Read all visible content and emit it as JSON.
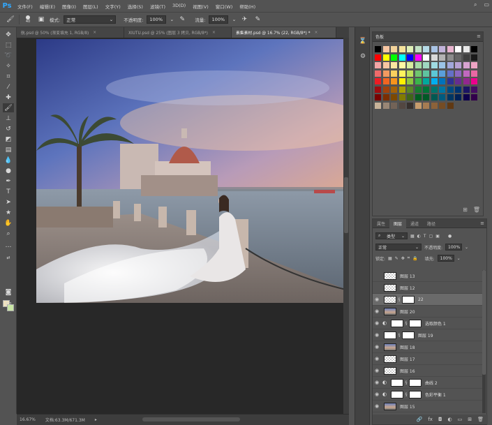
{
  "app": {
    "logo": "Ps"
  },
  "menus": [
    "文件(F)",
    "编辑(E)",
    "图像(I)",
    "图层(L)",
    "文字(Y)",
    "选择(S)",
    "滤镜(T)",
    "3D(D)",
    "视图(V)",
    "窗口(W)",
    "帮助(H)"
  ],
  "options": {
    "brush_size": "40",
    "mode_label": "模式:",
    "mode_value": "正常",
    "opacity_label": "不透明度:",
    "opacity_value": "100%",
    "flow_label": "流量:",
    "flow_value": "100%"
  },
  "tabs": [
    {
      "label": "航.psd @ 50% (渐变填充 1, RGB/8)",
      "close": "×"
    },
    {
      "label": "XIUTU.psd @ 25% (图层 3 拷贝, RGB/8*)",
      "close": "×"
    },
    {
      "label": "素集素材.psd @ 16.7% (22, RGB/8*) *",
      "close": "×"
    }
  ],
  "status": {
    "zoom": "16.67%",
    "doc": "文档:63.3M/671.3M"
  },
  "swatches": {
    "title": "色板",
    "colors": [
      [
        "#000000",
        "#f8c7a3",
        "#f2d29a",
        "#f5e39c",
        "#dff0b8",
        "#c1e0c4",
        "#b6dbe7",
        "#a9c3e4",
        "#c2b3da",
        "#e8b4cf",
        "#ffffff",
        "#e8e8e8",
        "#000000"
      ],
      [
        "#ff0000",
        "#ffff00",
        "#00ff00",
        "#00ffff",
        "#0000ff",
        "#ff00ff",
        "#ffffff",
        "#d9d9d9",
        "#b3b3b3",
        "#8c8c8c",
        "#666666",
        "#404040",
        "#1a1a1a"
      ],
      [
        "#f4a6a6",
        "#f7c6a1",
        "#fbe5a0",
        "#fff7a4",
        "#d7ed9f",
        "#a7dba6",
        "#9fd7c1",
        "#9fdbe2",
        "#9bc4e6",
        "#a2a8db",
        "#b7a1d3",
        "#d8a3d1",
        "#eea4c4"
      ],
      [
        "#ee6a6a",
        "#f29a60",
        "#f9d05e",
        "#fff35e",
        "#bfe05b",
        "#6fc56e",
        "#5fc3a0",
        "#5cc7d5",
        "#5a9fdb",
        "#6470c8",
        "#8b67c0",
        "#c068bf",
        "#e768a2"
      ],
      [
        "#ed1c24",
        "#f26522",
        "#f7941d",
        "#fff200",
        "#8dc63f",
        "#39b54a",
        "#00a99d",
        "#00aeef",
        "#0072bc",
        "#2e3192",
        "#662d91",
        "#92278f",
        "#ec008c"
      ],
      [
        "#9e0b0f",
        "#a0410d",
        "#a36209",
        "#aba000",
        "#598527",
        "#197b30",
        "#007236",
        "#00746b",
        "#0076a3",
        "#004a80",
        "#003471",
        "#1b1464",
        "#440e62"
      ],
      [
        "#790000",
        "#7b2e00",
        "#7d4900",
        "#827b00",
        "#406618",
        "#005e20",
        "#005826",
        "#005952",
        "#005b7f",
        "#003663",
        "#002157",
        "#0d004c",
        "#32004b"
      ],
      [
        "#c7b299",
        "#998675",
        "#736357",
        "#534741",
        "#37302d",
        "#c69c6d",
        "#a67c52",
        "#8c6239",
        "#754c24",
        "#603913"
      ]
    ]
  },
  "layers_panel": {
    "tabs": [
      "属性",
      "图层",
      "通道",
      "路径"
    ],
    "filter_label": "类型",
    "blend_mode": "正常",
    "opacity_label": "不透明度:",
    "opacity_value": "100%",
    "lock_label": "锁定:",
    "fill_label": "填充:",
    "fill_value": "100%",
    "layers": [
      {
        "name": "图层 13",
        "thumb": "trans"
      },
      {
        "name": "图层 12",
        "thumb": "trans"
      },
      {
        "name": "22",
        "thumb": "trans",
        "mask": true
      },
      {
        "name": "图层 20",
        "thumb": "photo",
        "visible": true
      },
      {
        "name": "选取颜色 1",
        "thumb": "white",
        "adjust": true,
        "visible": true
      },
      {
        "name": "图层 19",
        "thumb": "white",
        "mask": true,
        "visible": true
      },
      {
        "name": "图层 18",
        "thumb": "photo",
        "visible": true
      },
      {
        "name": "图层 17",
        "thumb": "trans",
        "visible": true
      },
      {
        "name": "图层 16",
        "thumb": "trans",
        "visible": true
      },
      {
        "name": "曲线 2",
        "thumb": "white",
        "adjust": true,
        "visible": true
      },
      {
        "name": "色彩平衡 1",
        "thumb": "white",
        "adjust": true,
        "visible": true
      },
      {
        "name": "图层 15",
        "thumb": "photo",
        "visible": true
      }
    ]
  }
}
